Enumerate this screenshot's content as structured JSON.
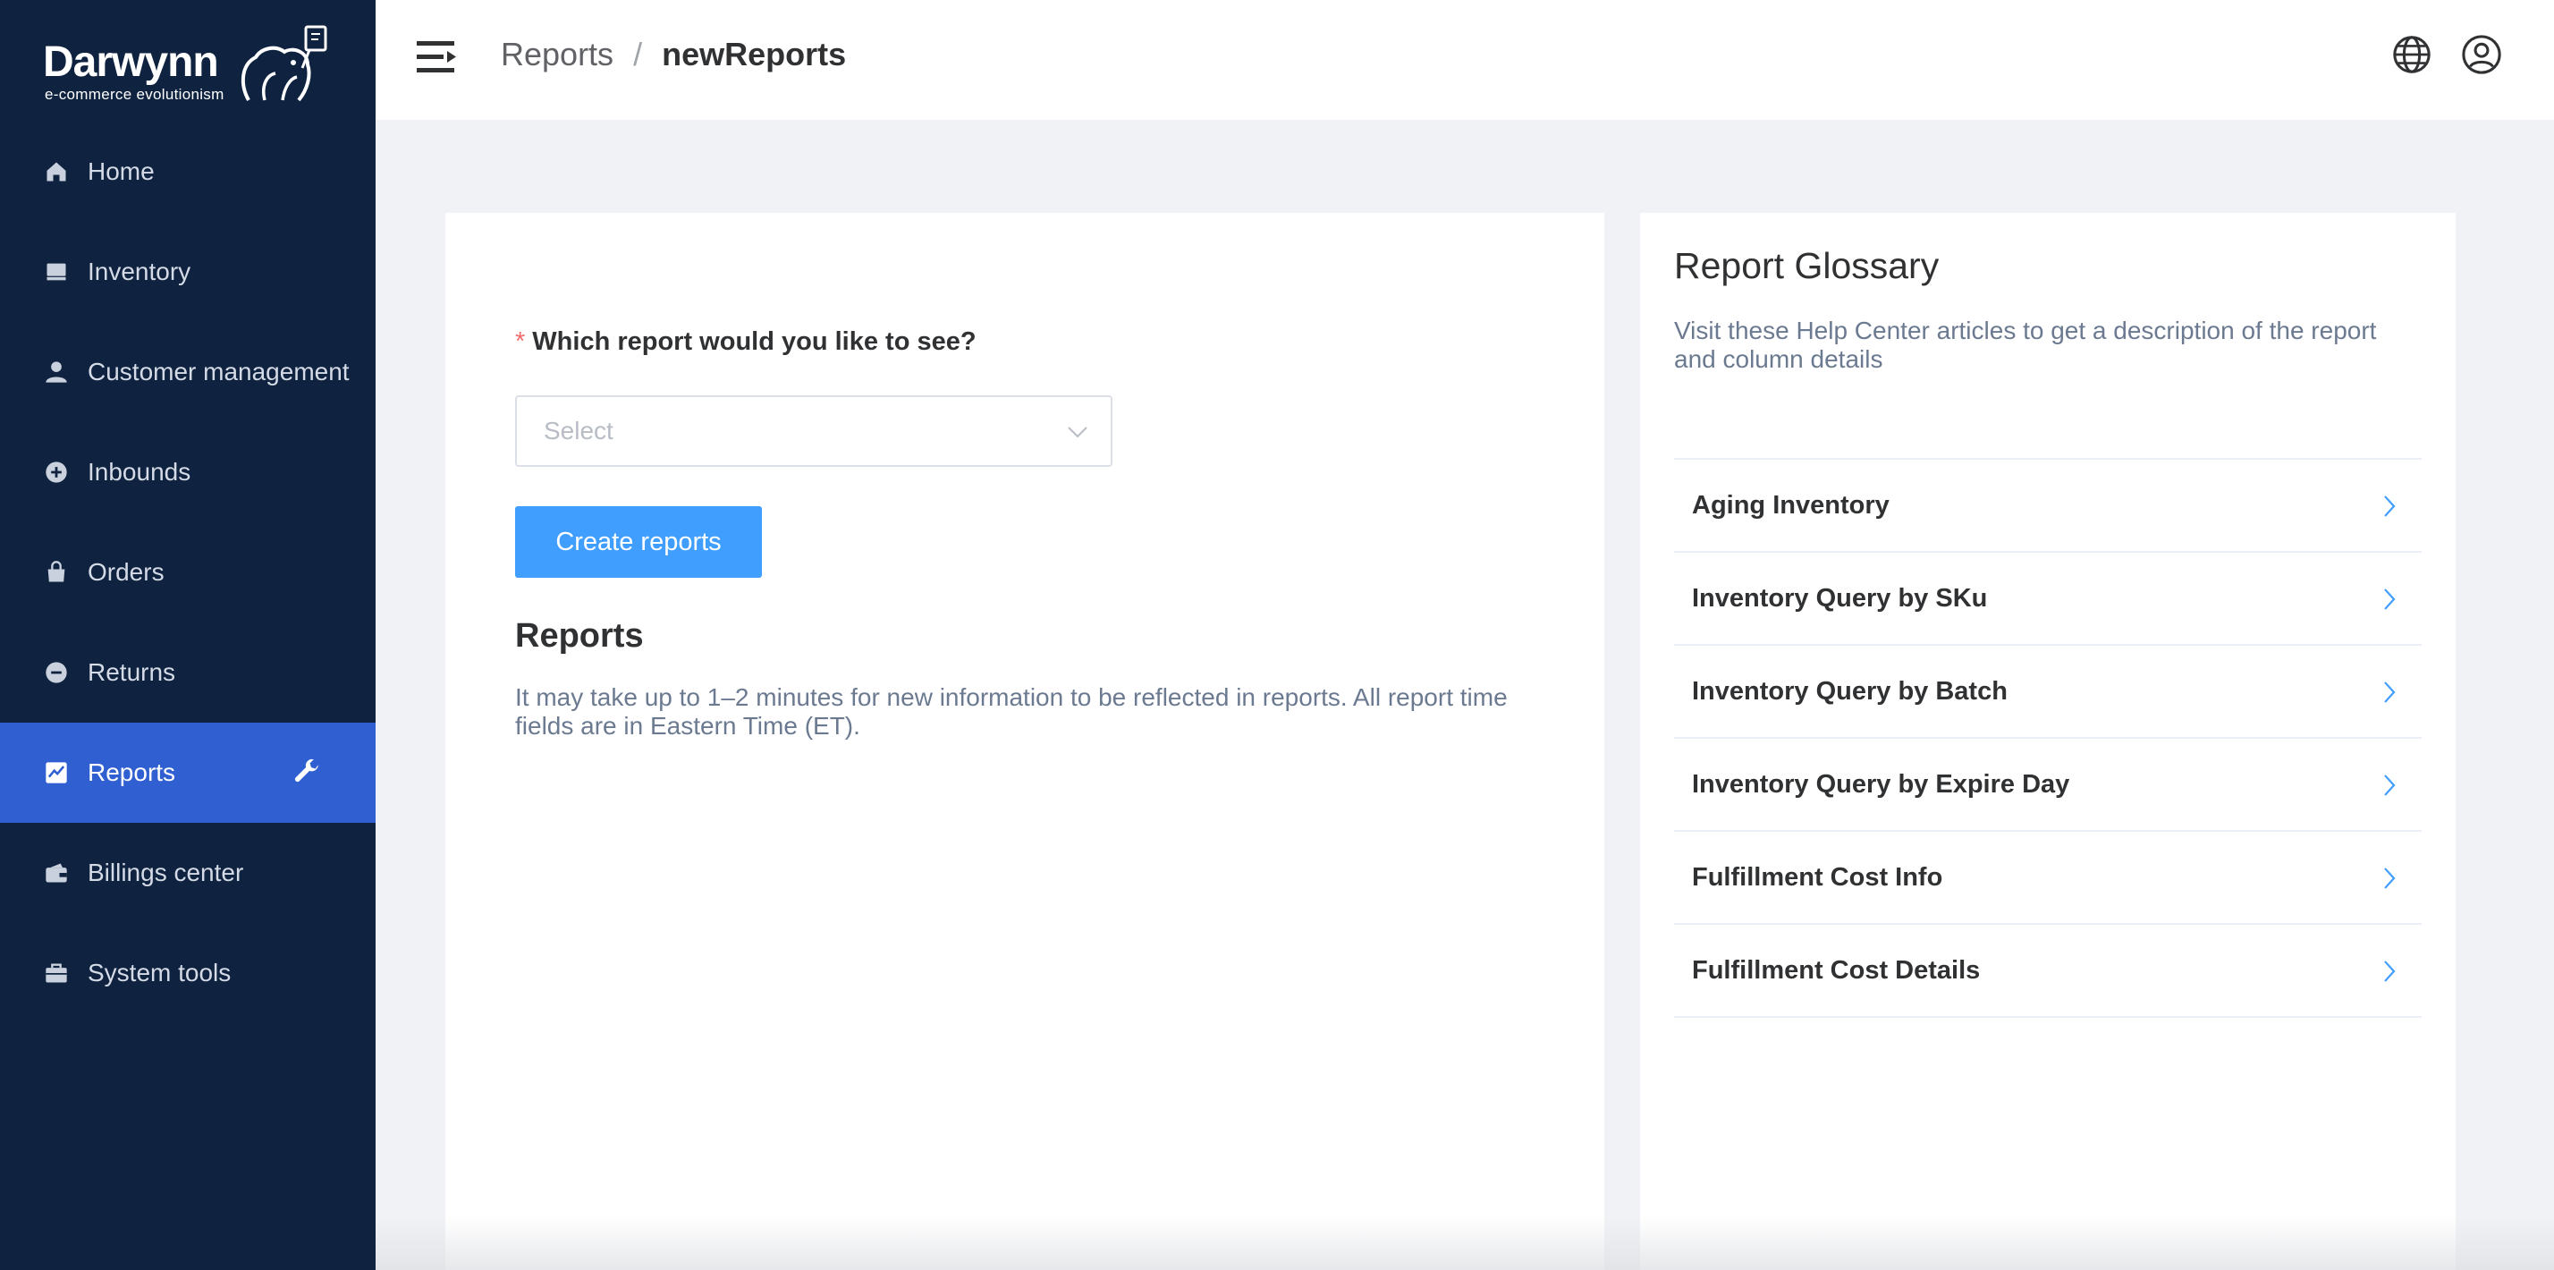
{
  "brand": {
    "name": "Darwynn",
    "tagline": "e-commerce evolutionism"
  },
  "sidebar": {
    "items": [
      {
        "label": "Home",
        "icon": "home-icon"
      },
      {
        "label": "Inventory",
        "icon": "inventory-icon"
      },
      {
        "label": "Customer management",
        "icon": "user-icon"
      },
      {
        "label": "Inbounds",
        "icon": "plus-circle-icon"
      },
      {
        "label": "Orders",
        "icon": "bag-icon"
      },
      {
        "label": "Returns",
        "icon": "minus-circle-icon"
      },
      {
        "label": "Reports",
        "icon": "chart-icon",
        "active": true
      },
      {
        "label": "Billings center",
        "icon": "wallet-icon"
      },
      {
        "label": "System tools",
        "icon": "toolbox-icon"
      }
    ],
    "active_color": "#2f5fd0",
    "background": "#0f223f"
  },
  "header": {
    "breadcrumb_parent": "Reports",
    "breadcrumb_separator": "/",
    "breadcrumb_current": "newReports"
  },
  "main": {
    "required_mark": "*",
    "question": "Which report would you like to see?",
    "select_placeholder": "Select",
    "create_button": "Create reports",
    "reports_title": "Reports",
    "reports_desc": "It may take up to 1–2 minutes for new information to be reflected in reports. All report time fields are in Eastern Time (ET)."
  },
  "glossary": {
    "title": "Report Glossary",
    "desc": "Visit these Help Center articles to get a description of the report and column details",
    "items": [
      "Aging Inventory",
      "Inventory Query by SKu",
      "Inventory Query by Batch",
      "Inventory Query by Expire Day",
      "Fulfillment Cost Info",
      "Fulfillment Cost Details"
    ]
  },
  "colors": {
    "primary_button": "#409eff",
    "required": "#f56c6c"
  }
}
